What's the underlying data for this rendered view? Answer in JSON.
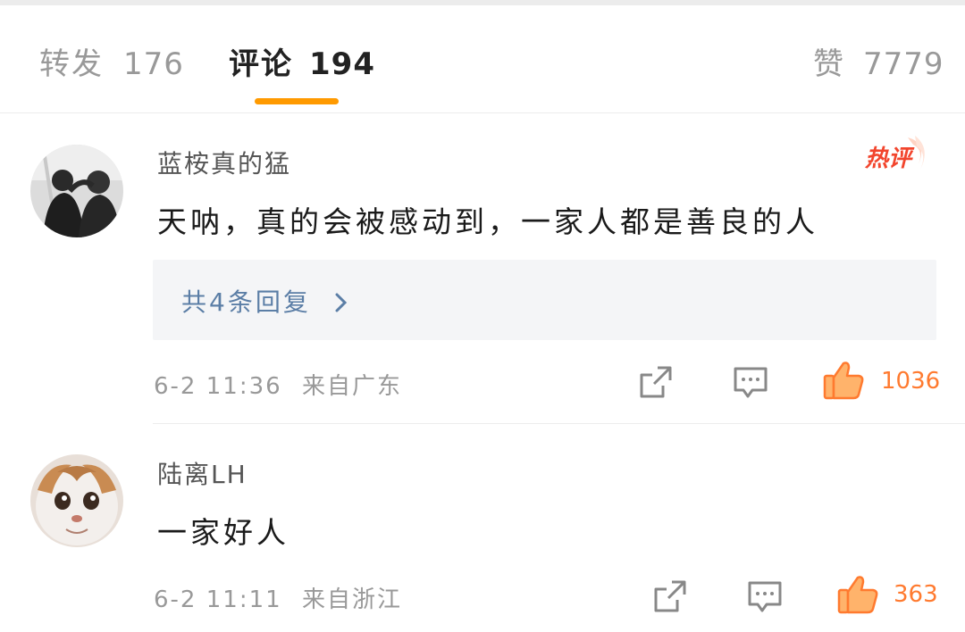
{
  "tabs": [
    {
      "label": "转发",
      "count": "176"
    },
    {
      "label": "评论",
      "count": "194"
    },
    {
      "label": "赞",
      "count": "7779"
    }
  ],
  "accent_color": "#ff9a00",
  "like_color": "#ff7a2f",
  "link_color": "#5b7ea6",
  "comments": [
    {
      "username": "蓝桉真的猛",
      "badge": "热评",
      "text": "天呐，真的会被感动到，一家人都是善良的人",
      "reply_link": "共4条回复",
      "date": "6-2",
      "time": "11:36",
      "location": "来自广东",
      "likes": "1036"
    },
    {
      "username": "陆离LH",
      "text": "一家好人",
      "date": "6-2",
      "time": "11:11",
      "location": "来自浙江",
      "likes": "363"
    }
  ],
  "icons": [
    "share-icon",
    "comment-icon",
    "like-icon",
    "chevron-right-icon"
  ]
}
